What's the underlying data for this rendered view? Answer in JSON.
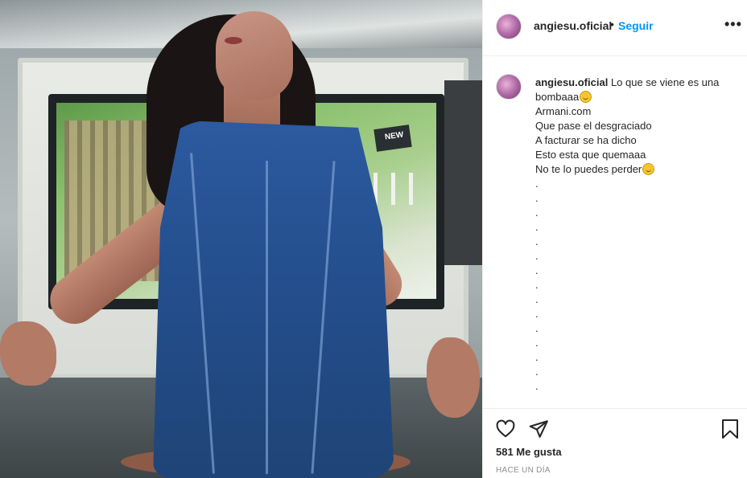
{
  "header": {
    "username": "angiesu.oficial",
    "separator": "•",
    "follow_label": "Seguir",
    "more_label": "•••"
  },
  "caption": {
    "username": "angiesu.oficial",
    "lines": [
      "Lo que se viene es una bombaaa",
      "Armani.com",
      "Que pase el desgraciado",
      "A facturar se ha dicho",
      "Esto esta que quemaaa",
      "No te lo puedes perder"
    ],
    "dots": [
      ".",
      ".",
      ".",
      ".",
      ".",
      ".",
      ".",
      ".",
      ".",
      ".",
      ".",
      ".",
      ".",
      ".",
      "."
    ]
  },
  "photo": {
    "tv_badge": "NEW"
  },
  "actions": {
    "likes_text": "581 Me gusta",
    "timestamp": "HACE UN DÍA"
  },
  "icons": {
    "like": "heart-icon",
    "share": "send-icon",
    "save": "bookmark-icon",
    "more": "more-options-icon",
    "emoji": "smiling-face-emoji"
  },
  "colors": {
    "accent": "#0095f6",
    "text": "#262626",
    "muted": "#8e8e8e",
    "divider": "#efefef"
  }
}
